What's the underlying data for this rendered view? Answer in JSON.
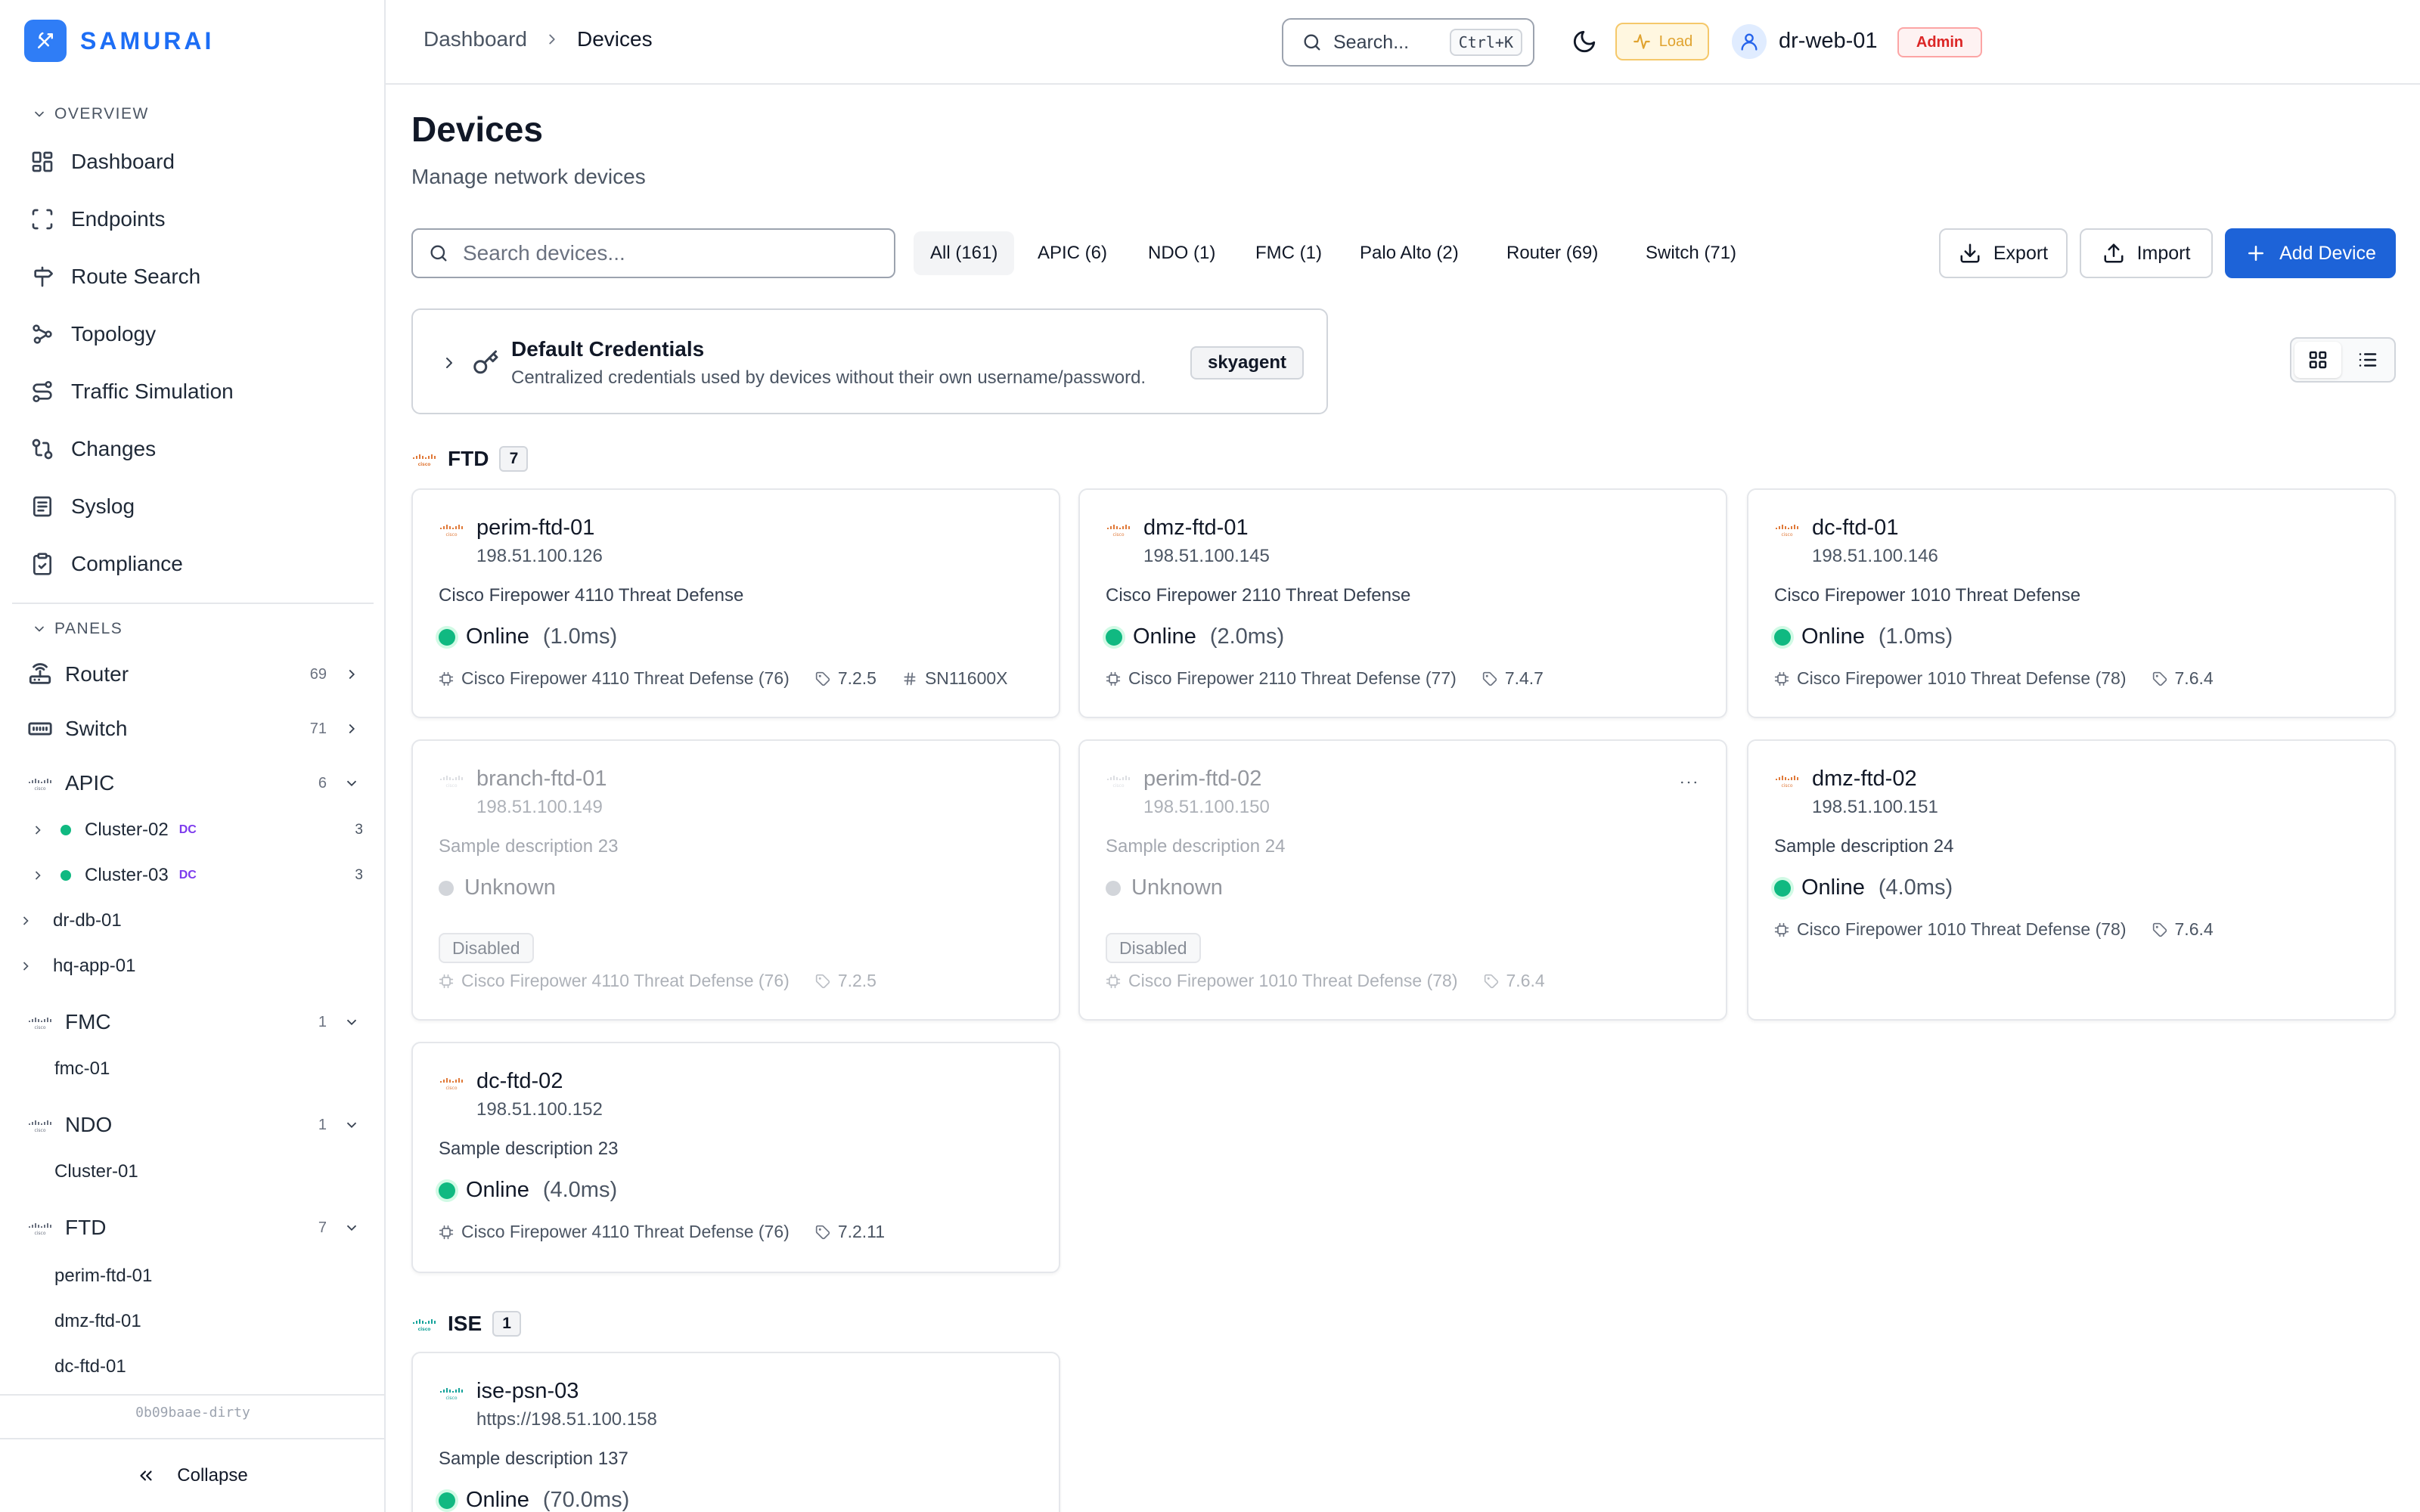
{
  "brand": {
    "name": "SAMURAI",
    "color": "#2f7df6"
  },
  "sidebar": {
    "overview_label": "OVERVIEW",
    "nav": [
      {
        "label": "Dashboard",
        "icon": "dashboard-grid-icon"
      },
      {
        "label": "Endpoints",
        "icon": "scan-frame-icon"
      },
      {
        "label": "Route Search",
        "icon": "signpost-icon"
      },
      {
        "label": "Topology",
        "icon": "network-icon"
      },
      {
        "label": "Traffic Simulation",
        "icon": "route-icon"
      },
      {
        "label": "Changes",
        "icon": "git-compare-icon"
      },
      {
        "label": "Syslog",
        "icon": "log-icon"
      },
      {
        "label": "Compliance",
        "icon": "clipboard-check-icon"
      }
    ],
    "panels_label": "PANELS",
    "panels": {
      "router": {
        "label": "Router",
        "count": "69"
      },
      "switch": {
        "label": "Switch",
        "count": "71"
      },
      "apic": {
        "label": "APIC",
        "count": "6"
      },
      "cluster02": {
        "label": "Cluster-02",
        "badge": "DC",
        "count": "3"
      },
      "cluster03": {
        "label": "Cluster-03",
        "badge": "DC",
        "count": "3"
      },
      "drdb": {
        "label": "dr-db-01"
      },
      "hqapp": {
        "label": "hq-app-01"
      },
      "fmc": {
        "label": "FMC",
        "count": "1"
      },
      "fmc01": {
        "label": "fmc-01"
      },
      "ndo": {
        "label": "NDO",
        "count": "1"
      },
      "ndocluster": {
        "label": "Cluster-01"
      },
      "ftd": {
        "label": "FTD",
        "count": "7"
      },
      "ftd_items": [
        "perim-ftd-01",
        "dmz-ftd-01",
        "dc-ftd-01"
      ]
    },
    "version": "0b09baae-dirty",
    "collapse_label": "Collapse"
  },
  "topbar": {
    "breadcrumb_root": "Dashboard",
    "breadcrumb_current": "Devices",
    "search_placeholder": "Search...",
    "search_shortcut": "Ctrl+K",
    "load_label": "Load",
    "user_name": "dr-web-01",
    "user_role": "Admin"
  },
  "page": {
    "title": "Devices",
    "subtitle": "Manage network devices",
    "search_placeholder": "Search devices...",
    "filters": [
      "All (161)",
      "APIC (6)",
      "NDO (1)",
      "FMC (1)",
      "Palo Alto (2)",
      "Router (69)",
      "Switch (71)"
    ],
    "export_label": "Export",
    "import_label": "Import",
    "add_label": "Add Device",
    "accent_color": "#1d63d8"
  },
  "credentials": {
    "title": "Default Credentials",
    "description": "Centralized credentials used by devices without their own username/password.",
    "username": "skyagent"
  },
  "groups": {
    "ftd": {
      "name": "FTD",
      "count": "7",
      "devices": [
        {
          "name": "perim-ftd-01",
          "ip": "198.51.100.126",
          "description": "Cisco Firepower 4110 Threat Defense",
          "status": "Online",
          "latency": "(1.0ms)",
          "model": "Cisco Firepower 4110 Threat Defense (76)",
          "version": "7.2.5",
          "serial": "SN11600X"
        },
        {
          "name": "dmz-ftd-01",
          "ip": "198.51.100.145",
          "description": "Cisco Firepower 2110 Threat Defense",
          "status": "Online",
          "latency": "(2.0ms)",
          "model": "Cisco Firepower 2110 Threat Defense (77)",
          "version": "7.4.7"
        },
        {
          "name": "dc-ftd-01",
          "ip": "198.51.100.146",
          "description": "Cisco Firepower 1010 Threat Defense",
          "status": "Online",
          "latency": "(1.0ms)",
          "model": "Cisco Firepower 1010 Threat Defense (78)",
          "version": "7.6.4"
        },
        {
          "name": "branch-ftd-01",
          "ip": "198.51.100.149",
          "description": "Sample description 23",
          "status": "Unknown",
          "disabled": "Disabled",
          "model": "Cisco Firepower 4110 Threat Defense (76)",
          "version": "7.2.5"
        },
        {
          "name": "perim-ftd-02",
          "ip": "198.51.100.150",
          "description": "Sample description 24",
          "status": "Unknown",
          "disabled": "Disabled",
          "model": "Cisco Firepower 1010 Threat Defense (78)",
          "version": "7.6.4"
        },
        {
          "name": "dmz-ftd-02",
          "ip": "198.51.100.151",
          "description": "Sample description 24",
          "status": "Online",
          "latency": "(4.0ms)",
          "model": "Cisco Firepower 1010 Threat Defense (78)",
          "version": "7.6.4"
        },
        {
          "name": "dc-ftd-02",
          "ip": "198.51.100.152",
          "description": "Sample description 23",
          "status": "Online",
          "latency": "(4.0ms)",
          "model": "Cisco Firepower 4110 Threat Defense (76)",
          "version": "7.2.11"
        }
      ]
    },
    "ise": {
      "name": "ISE",
      "count": "1",
      "devices": [
        {
          "name": "ise-psn-03",
          "ip": "https://198.51.100.158",
          "description": "Sample description 137",
          "status": "Online",
          "latency": "(70.0ms)"
        }
      ]
    }
  },
  "colors": {
    "online": "#10b981",
    "unknown": "#9ca3af",
    "cisco_ftd": "#e07a3a",
    "cisco_ise": "#16a39a",
    "admin_badge": "#dc2626",
    "load_chip": "#e0a32f"
  }
}
